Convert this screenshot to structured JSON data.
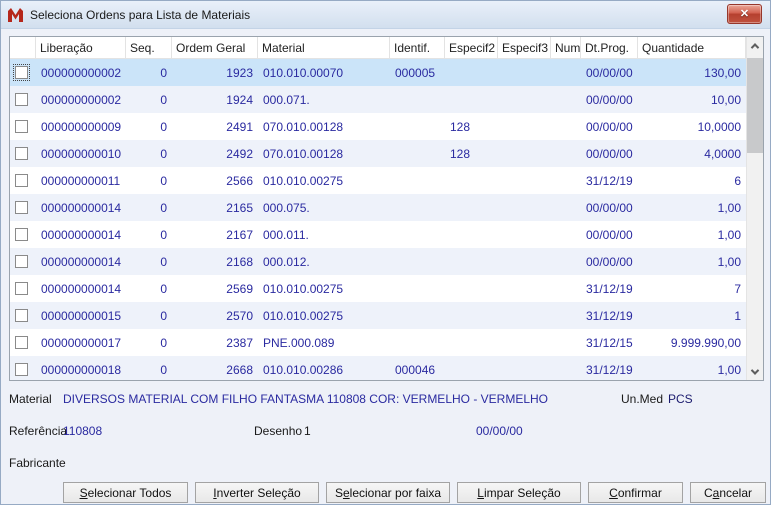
{
  "window": {
    "title": "Seleciona Ordens para Lista de Materiais"
  },
  "colors": {
    "selected_row": "#cbe4f9",
    "alt_row": "#eef2fa",
    "grid_text": "#2a2aa0",
    "close_button_red": "#b5402e"
  },
  "table": {
    "columns": [
      {
        "key": "liberacao",
        "label": "Liberação"
      },
      {
        "key": "seq",
        "label": "Seq."
      },
      {
        "key": "ordem",
        "label": "Ordem Geral"
      },
      {
        "key": "material",
        "label": "Material"
      },
      {
        "key": "identif",
        "label": "Identif."
      },
      {
        "key": "especif2",
        "label": "Especif2"
      },
      {
        "key": "especif3",
        "label": "Especif3"
      },
      {
        "key": "num",
        "label": "Num"
      },
      {
        "key": "dtprog",
        "label": "Dt.Prog."
      },
      {
        "key": "quantidade",
        "label": "Quantidade"
      }
    ],
    "rows": [
      {
        "selected": true,
        "liberacao": "000000000002",
        "seq": "0",
        "ordem": "1923",
        "material": "010.010.00070",
        "identif": "000005",
        "especif2": "",
        "especif3": "",
        "num": "",
        "dtprog": "00/00/00",
        "quantidade": "130,00"
      },
      {
        "selected": false,
        "liberacao": "000000000002",
        "seq": "0",
        "ordem": "1924",
        "material": "000.071.",
        "identif": "",
        "especif2": "",
        "especif3": "",
        "num": "",
        "dtprog": "00/00/00",
        "quantidade": "10,00"
      },
      {
        "selected": false,
        "liberacao": "000000000009",
        "seq": "0",
        "ordem": "2491",
        "material": "070.010.00128",
        "identif": "",
        "especif2": "128",
        "especif3": "",
        "num": "",
        "dtprog": "00/00/00",
        "quantidade": "10,0000"
      },
      {
        "selected": false,
        "liberacao": "000000000010",
        "seq": "0",
        "ordem": "2492",
        "material": "070.010.00128",
        "identif": "",
        "especif2": "128",
        "especif3": "",
        "num": "",
        "dtprog": "00/00/00",
        "quantidade": "4,0000"
      },
      {
        "selected": false,
        "liberacao": "000000000011",
        "seq": "0",
        "ordem": "2566",
        "material": "010.010.00275",
        "identif": "",
        "especif2": "",
        "especif3": "",
        "num": "",
        "dtprog": "31/12/19",
        "quantidade": "6"
      },
      {
        "selected": false,
        "liberacao": "000000000014",
        "seq": "0",
        "ordem": "2165",
        "material": "000.075.",
        "identif": "",
        "especif2": "",
        "especif3": "",
        "num": "",
        "dtprog": "00/00/00",
        "quantidade": "1,00"
      },
      {
        "selected": false,
        "liberacao": "000000000014",
        "seq": "0",
        "ordem": "2167",
        "material": "000.011.",
        "identif": "",
        "especif2": "",
        "especif3": "",
        "num": "",
        "dtprog": "00/00/00",
        "quantidade": "1,00"
      },
      {
        "selected": false,
        "liberacao": "000000000014",
        "seq": "0",
        "ordem": "2168",
        "material": "000.012.",
        "identif": "",
        "especif2": "",
        "especif3": "",
        "num": "",
        "dtprog": "00/00/00",
        "quantidade": "1,00"
      },
      {
        "selected": false,
        "liberacao": "000000000014",
        "seq": "0",
        "ordem": "2569",
        "material": "010.010.00275",
        "identif": "",
        "especif2": "",
        "especif3": "",
        "num": "",
        "dtprog": "31/12/19",
        "quantidade": "7"
      },
      {
        "selected": false,
        "liberacao": "000000000015",
        "seq": "0",
        "ordem": "2570",
        "material": "010.010.00275",
        "identif": "",
        "especif2": "",
        "especif3": "",
        "num": "",
        "dtprog": "31/12/19",
        "quantidade": "1"
      },
      {
        "selected": false,
        "liberacao": "000000000017",
        "seq": "0",
        "ordem": "2387",
        "material": "PNE.000.089",
        "identif": "",
        "especif2": "",
        "especif3": "",
        "num": "",
        "dtprog": "31/12/15",
        "quantidade": "9.999.990,00"
      },
      {
        "selected": false,
        "liberacao": "000000000018",
        "seq": "0",
        "ordem": "2668",
        "material": "010.010.00286",
        "identif": "000046",
        "especif2": "",
        "especif3": "",
        "num": "",
        "dtprog": "31/12/19",
        "quantidade": "1,00"
      }
    ]
  },
  "fields": {
    "material_label": "Material",
    "material_value": "DIVERSOS MATERIAL COM FILHO FANTASMA 110808 COR: VERMELHO - VERMELHO",
    "unmed_label": "Un.Med",
    "unmed_value": "PCS",
    "referencia_label": "Referência",
    "referencia_value": "110808",
    "desenho_label": "Desenho",
    "desenho_value": "1",
    "data_value": "00/00/00",
    "fabricante_label": "Fabricante"
  },
  "buttons": [
    {
      "label": "Selecionar Todos",
      "underline": 0
    },
    {
      "label": "Inverter Seleção",
      "underline": 0
    },
    {
      "label": "Selecionar por faixa",
      "underline": 1
    },
    {
      "label": "Limpar Seleção",
      "underline": 0
    },
    {
      "label": "Confirmar",
      "underline": 0
    },
    {
      "label": "Cancelar",
      "underline": 1
    }
  ]
}
